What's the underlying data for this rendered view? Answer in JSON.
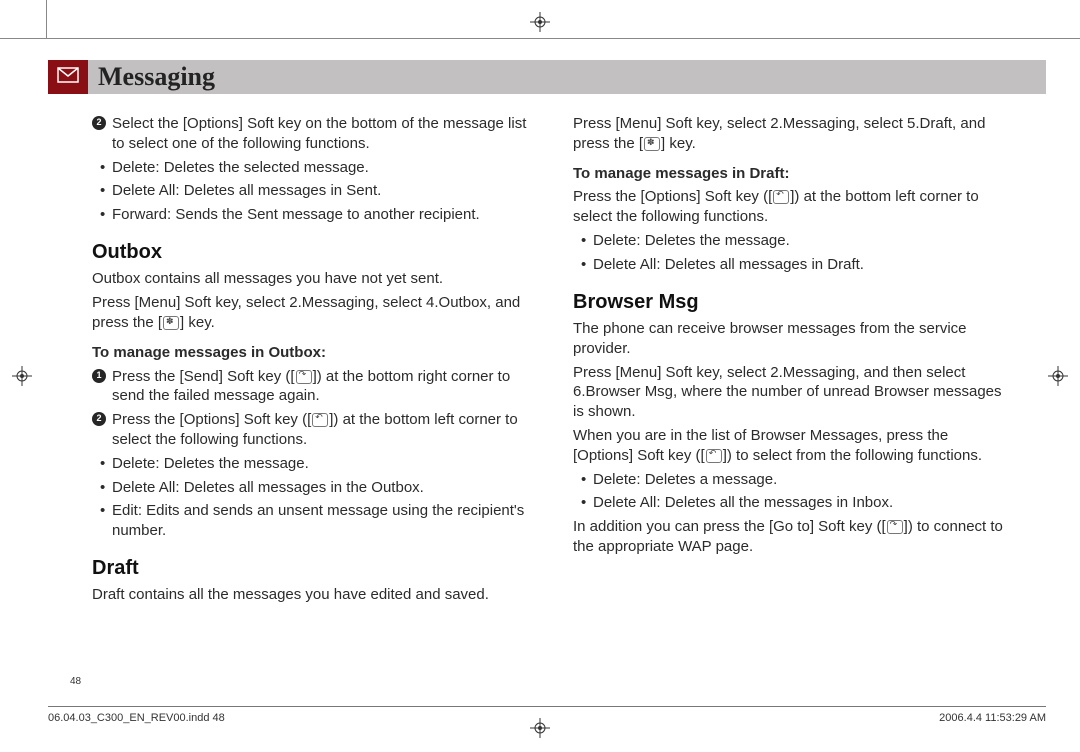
{
  "header": {
    "title": "Messaging"
  },
  "col1": {
    "step2": "Select the [Options] Soft key on the bottom of the message list to select one of the following functions.",
    "b1": "Delete: Deletes the selected message.",
    "b2": "Delete All: Deletes all messages in Sent.",
    "b3": "Forward: Sends the Sent message to another recipient.",
    "h_outbox": "Outbox",
    "outbox_p1": "Outbox contains all messages you have not yet sent.",
    "outbox_p2a": "Press [Menu] Soft key, select 2.Messaging, select 4.Outbox, and press the [",
    "outbox_p2b": "] key.",
    "h_outbox_mgmt": "To manage messages in Outbox:",
    "outbox_n1a": "Press the [Send] Soft key ([",
    "outbox_n1b": "]) at the bottom right corner to send the failed message again.",
    "outbox_n2a": "Press the [Options] Soft key ([",
    "outbox_n2b": "]) at the bottom left corner to select the following functions.",
    "ob1": "Delete: Deletes the message.",
    "ob2": "Delete All: Deletes all messages in the Outbox.",
    "ob3": "Edit: Edits and sends an unsent message using the recipient's number.",
    "h_draft": "Draft",
    "draft_p1": "Draft contains all the messages you have edited and saved."
  },
  "col2": {
    "draft_nav_a": "Press [Menu] Soft key, select 2.Messaging, select 5.Draft, and press the [",
    "draft_nav_b": "] key.",
    "h_draft_mgmt": "To manage messages in Draft:",
    "draft_opt_a": "Press the [Options] Soft key ([",
    "draft_opt_b": "]) at the bottom left corner to select the following functions.",
    "db1": "Delete: Deletes the message.",
    "db2": "Delete All: Deletes all messages in Draft.",
    "h_browser": "Browser Msg",
    "br_p1": "The phone can receive browser messages from the service provider.",
    "br_p2": "Press [Menu] Soft key, select 2.Messaging, and then select 6.Browser Msg, where the number of unread Browser messages is shown.",
    "br_p3a": "When you are in the list of Browser Messages, press the [Options] Soft key ([",
    "br_p3b": "]) to select from the following functions.",
    "bb1": "Delete: Deletes a message.",
    "bb2": "Delete All: Deletes all the messages in Inbox.",
    "br_p4a": "In addition you can press the [Go to] Soft key ([",
    "br_p4b": "]) to connect to the appropriate WAP page."
  },
  "page_number": "48",
  "footer": {
    "left": "06.04.03_C300_EN_REV00.indd   48",
    "right": "2006.4.4   11:53:29 AM"
  }
}
